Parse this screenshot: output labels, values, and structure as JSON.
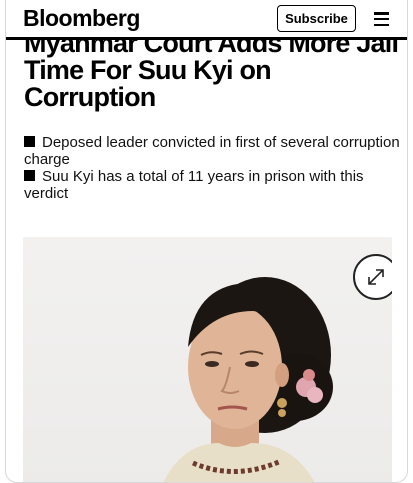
{
  "header": {
    "logo": "Bloomberg",
    "subscribe_label": "Subscribe",
    "menu_icon": "hamburger-menu-icon"
  },
  "article": {
    "headline": "Myanmar Court Adds More Jail Time For Suu Kyi on Corruption",
    "bullets": [
      "Deposed leader convicted in first of several corruption charge",
      "Suu Kyi has a total of 11 years in prison with this verdict"
    ]
  },
  "image": {
    "expand_icon": "expand-arrows-icon"
  },
  "colors": {
    "text": "#000000",
    "background": "#ffffff",
    "photo_background": "#efeeed"
  }
}
